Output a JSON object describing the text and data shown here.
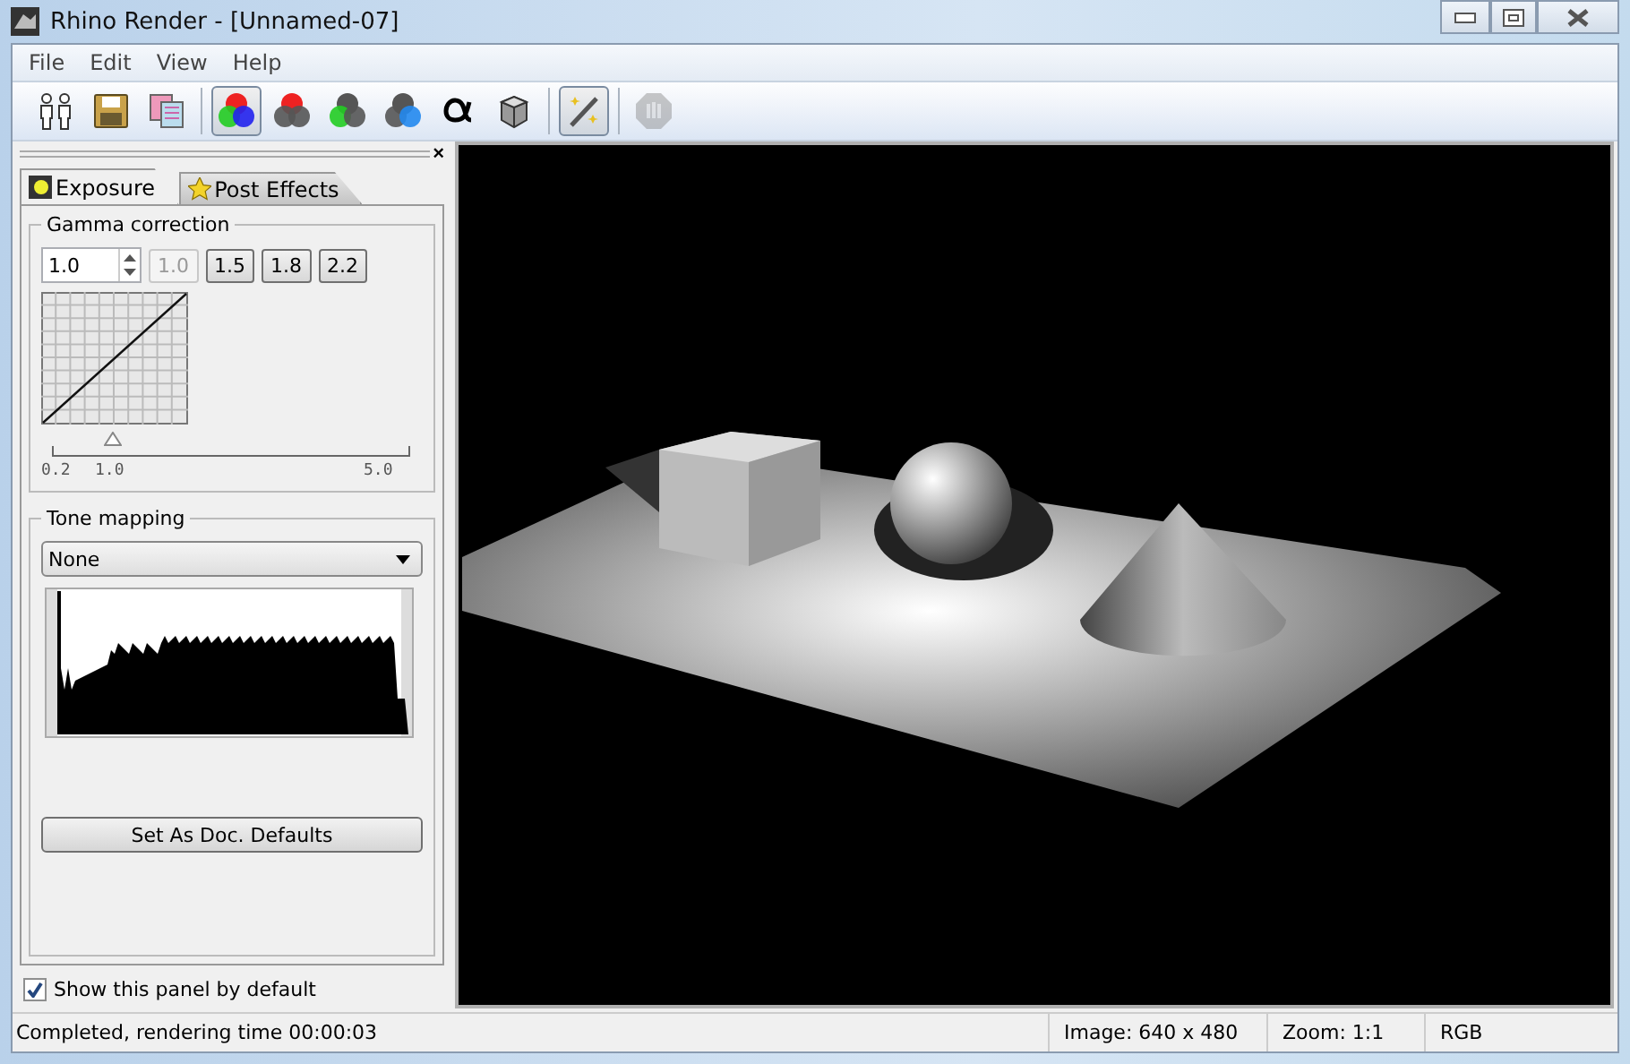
{
  "window": {
    "title": "Rhino Render - [Unnamed-07]"
  },
  "menu": [
    "File",
    "Edit",
    "View",
    "Help"
  ],
  "toolbar": [
    [
      {
        "kind": "people",
        "selected": false,
        "disabled": false
      },
      {
        "kind": "save",
        "selected": false,
        "disabled": false
      },
      {
        "kind": "copy",
        "selected": false,
        "disabled": false
      }
    ],
    [
      {
        "kind": "rgb",
        "selected": true,
        "disabled": false
      },
      {
        "kind": "red",
        "selected": false,
        "disabled": false
      },
      {
        "kind": "green",
        "selected": false,
        "disabled": false
      },
      {
        "kind": "blue",
        "selected": false,
        "disabled": false
      },
      {
        "kind": "alpha",
        "selected": false,
        "disabled": false
      },
      {
        "kind": "cube",
        "selected": false,
        "disabled": false
      }
    ],
    [
      {
        "kind": "wand",
        "selected": true,
        "disabled": false
      }
    ],
    [
      {
        "kind": "stop",
        "selected": false,
        "disabled": true
      }
    ]
  ],
  "panel": {
    "close": "×",
    "tabs": [
      {
        "label": "Exposure",
        "selected": true
      },
      {
        "label": "Post Effects",
        "selected": false
      }
    ],
    "gamma": {
      "title": "Gamma correction",
      "value": "1.0",
      "presets": [
        {
          "label": "1.0",
          "disabled": true
        },
        {
          "label": "1.5",
          "disabled": false
        },
        {
          "label": "1.8",
          "disabled": false
        },
        {
          "label": "2.2",
          "disabled": false
        }
      ],
      "slider": {
        "level": 0.167,
        "labels": [
          "0.2",
          "1.0",
          "5.0"
        ]
      }
    },
    "tone": {
      "title": "Tone mapping",
      "value": "None",
      "button": "Set As Doc. Defaults"
    },
    "show_by_default": {
      "label": "Show this panel by default",
      "checked": true
    }
  },
  "status_bar": [
    "Completed, rendering time 00:00:03",
    "Image: 640 x 480",
    "Zoom: 1:1",
    "RGB"
  ]
}
